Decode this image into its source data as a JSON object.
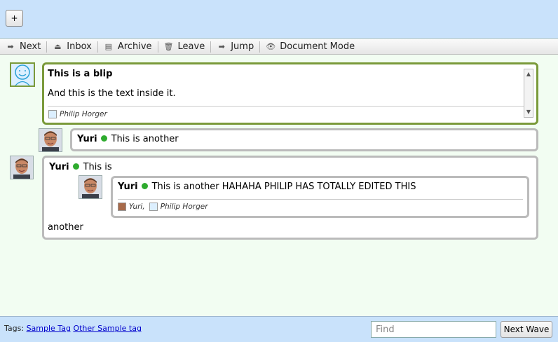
{
  "top": {
    "new_wave_label": "+"
  },
  "toolbar": {
    "items": [
      {
        "label": "Next",
        "icon": "arrow-right-icon"
      },
      {
        "label": "Inbox",
        "icon": "inbox-icon"
      },
      {
        "label": "Archive",
        "icon": "archive-icon"
      },
      {
        "label": "Leave",
        "icon": "trash-icon"
      },
      {
        "label": "Jump",
        "icon": "arrow-right-icon"
      },
      {
        "label": "Document Mode",
        "icon": "eye-icon"
      }
    ]
  },
  "blips": {
    "first": {
      "title": "This is a blip",
      "body": "And this is the text inside it.",
      "contributor": "Philip Horger"
    },
    "second": {
      "author": "Yuri",
      "text": "This is another"
    },
    "third": {
      "author": "Yuri",
      "text_before": "This is",
      "text_after": "another",
      "nested": {
        "author": "Yuri",
        "text": "This is another HAHAHA PHILIP HAS TOTALLY EDITED THIS",
        "contributor_1": "Yuri,",
        "contributor_2": "Philip Horger"
      }
    }
  },
  "footer": {
    "tags_label": "Tags:",
    "tags": [
      "Sample Tag",
      "Other Sample tag"
    ],
    "find_placeholder": "Find",
    "next_wave_label": "Next Wave"
  },
  "colors": {
    "header_bg": "#c9e2fb",
    "content_bg": "#f2fdf2",
    "active_blip_border": "#7a9a3a",
    "online_dot": "#2eab2e"
  }
}
